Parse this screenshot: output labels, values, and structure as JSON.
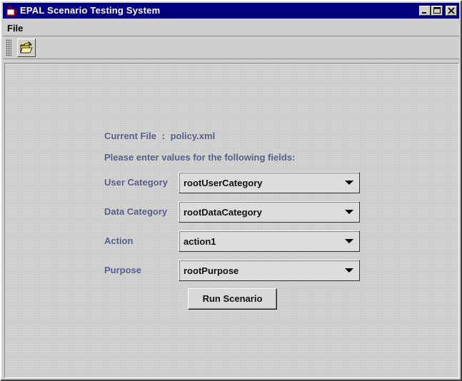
{
  "window": {
    "title": "EPAL Scenario Testing System"
  },
  "menubar": {
    "file_label": "File"
  },
  "toolbar": {
    "open_icon": "open-folder-icon"
  },
  "form": {
    "current_file_label": "Current File",
    "current_file_sep": ":",
    "current_file_value": "policy.xml",
    "instructions": "Please enter values for the following fields:",
    "fields": [
      {
        "label": "User Category",
        "value": "rootUserCategory"
      },
      {
        "label": "Data Category",
        "value": "rootDataCategory"
      },
      {
        "label": "Action",
        "value": "action1"
      },
      {
        "label": "Purpose",
        "value": "rootPurpose"
      }
    ],
    "run_label": "Run Scenario"
  },
  "colors": {
    "titlebar": "#000080",
    "label_text": "#5a5f8a",
    "panel": "#cdcdcd"
  }
}
